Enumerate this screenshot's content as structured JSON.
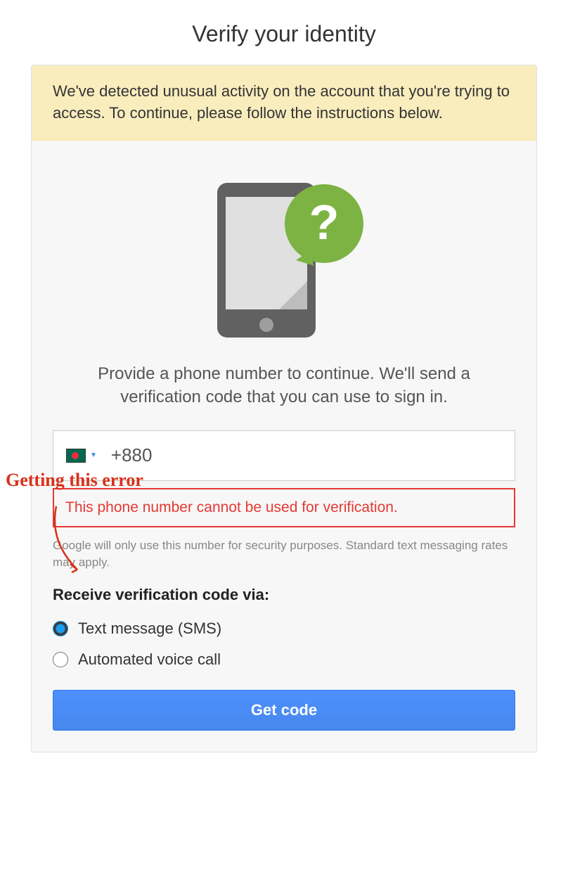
{
  "title": "Verify your identity",
  "alert": "We've detected unusual activity on the account that you're trying to access. To continue, please follow the instructions below.",
  "instructions": "Provide a phone number to continue. We'll send a verification code that you can use to sign in.",
  "phone": {
    "country_flag": "bangladesh",
    "value": "+880"
  },
  "error": "This phone number cannot be used for verification.",
  "disclaimer": "Google will only use this number for security purposes. Standard text messaging rates may apply.",
  "receive_label": "Receive verification code via:",
  "options": {
    "sms": "Text message (SMS)",
    "voice": "Automated voice call"
  },
  "button": "Get code",
  "annotation": "Getting this error"
}
